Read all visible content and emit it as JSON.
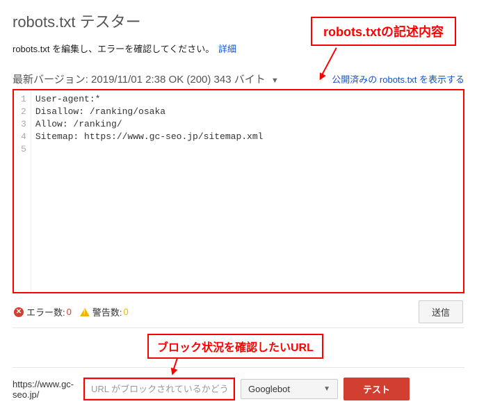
{
  "header": {
    "title": "robots.txt テスター",
    "instruction": "robots.txt を編集し、エラーを確認してください。",
    "detail_link": "詳細"
  },
  "annotations": {
    "callout1": "robots.txtの記述内容",
    "callout2": "ブロック状況を確認したいURL"
  },
  "version_bar": {
    "text": "最新バージョン: 2019/11/01 2:38 OK (200)   343 バイト",
    "show_published": "公開済みの robots.txt を表示する"
  },
  "editor": {
    "lines": [
      "User-agent:*",
      "Disallow: /ranking/osaka",
      "Allow: /ranking/",
      "",
      "Sitemap: https://www.gc-seo.jp/sitemap.xml"
    ]
  },
  "status": {
    "error_label": "エラー数:",
    "error_count": "0",
    "warn_label": "警告数:",
    "warn_count": "0",
    "send_button": "送信"
  },
  "test": {
    "domain": "https://www.gc-seo.jp/",
    "placeholder": "URL がブロックされているかどうか",
    "bot": "Googlebot",
    "button": "テスト"
  }
}
